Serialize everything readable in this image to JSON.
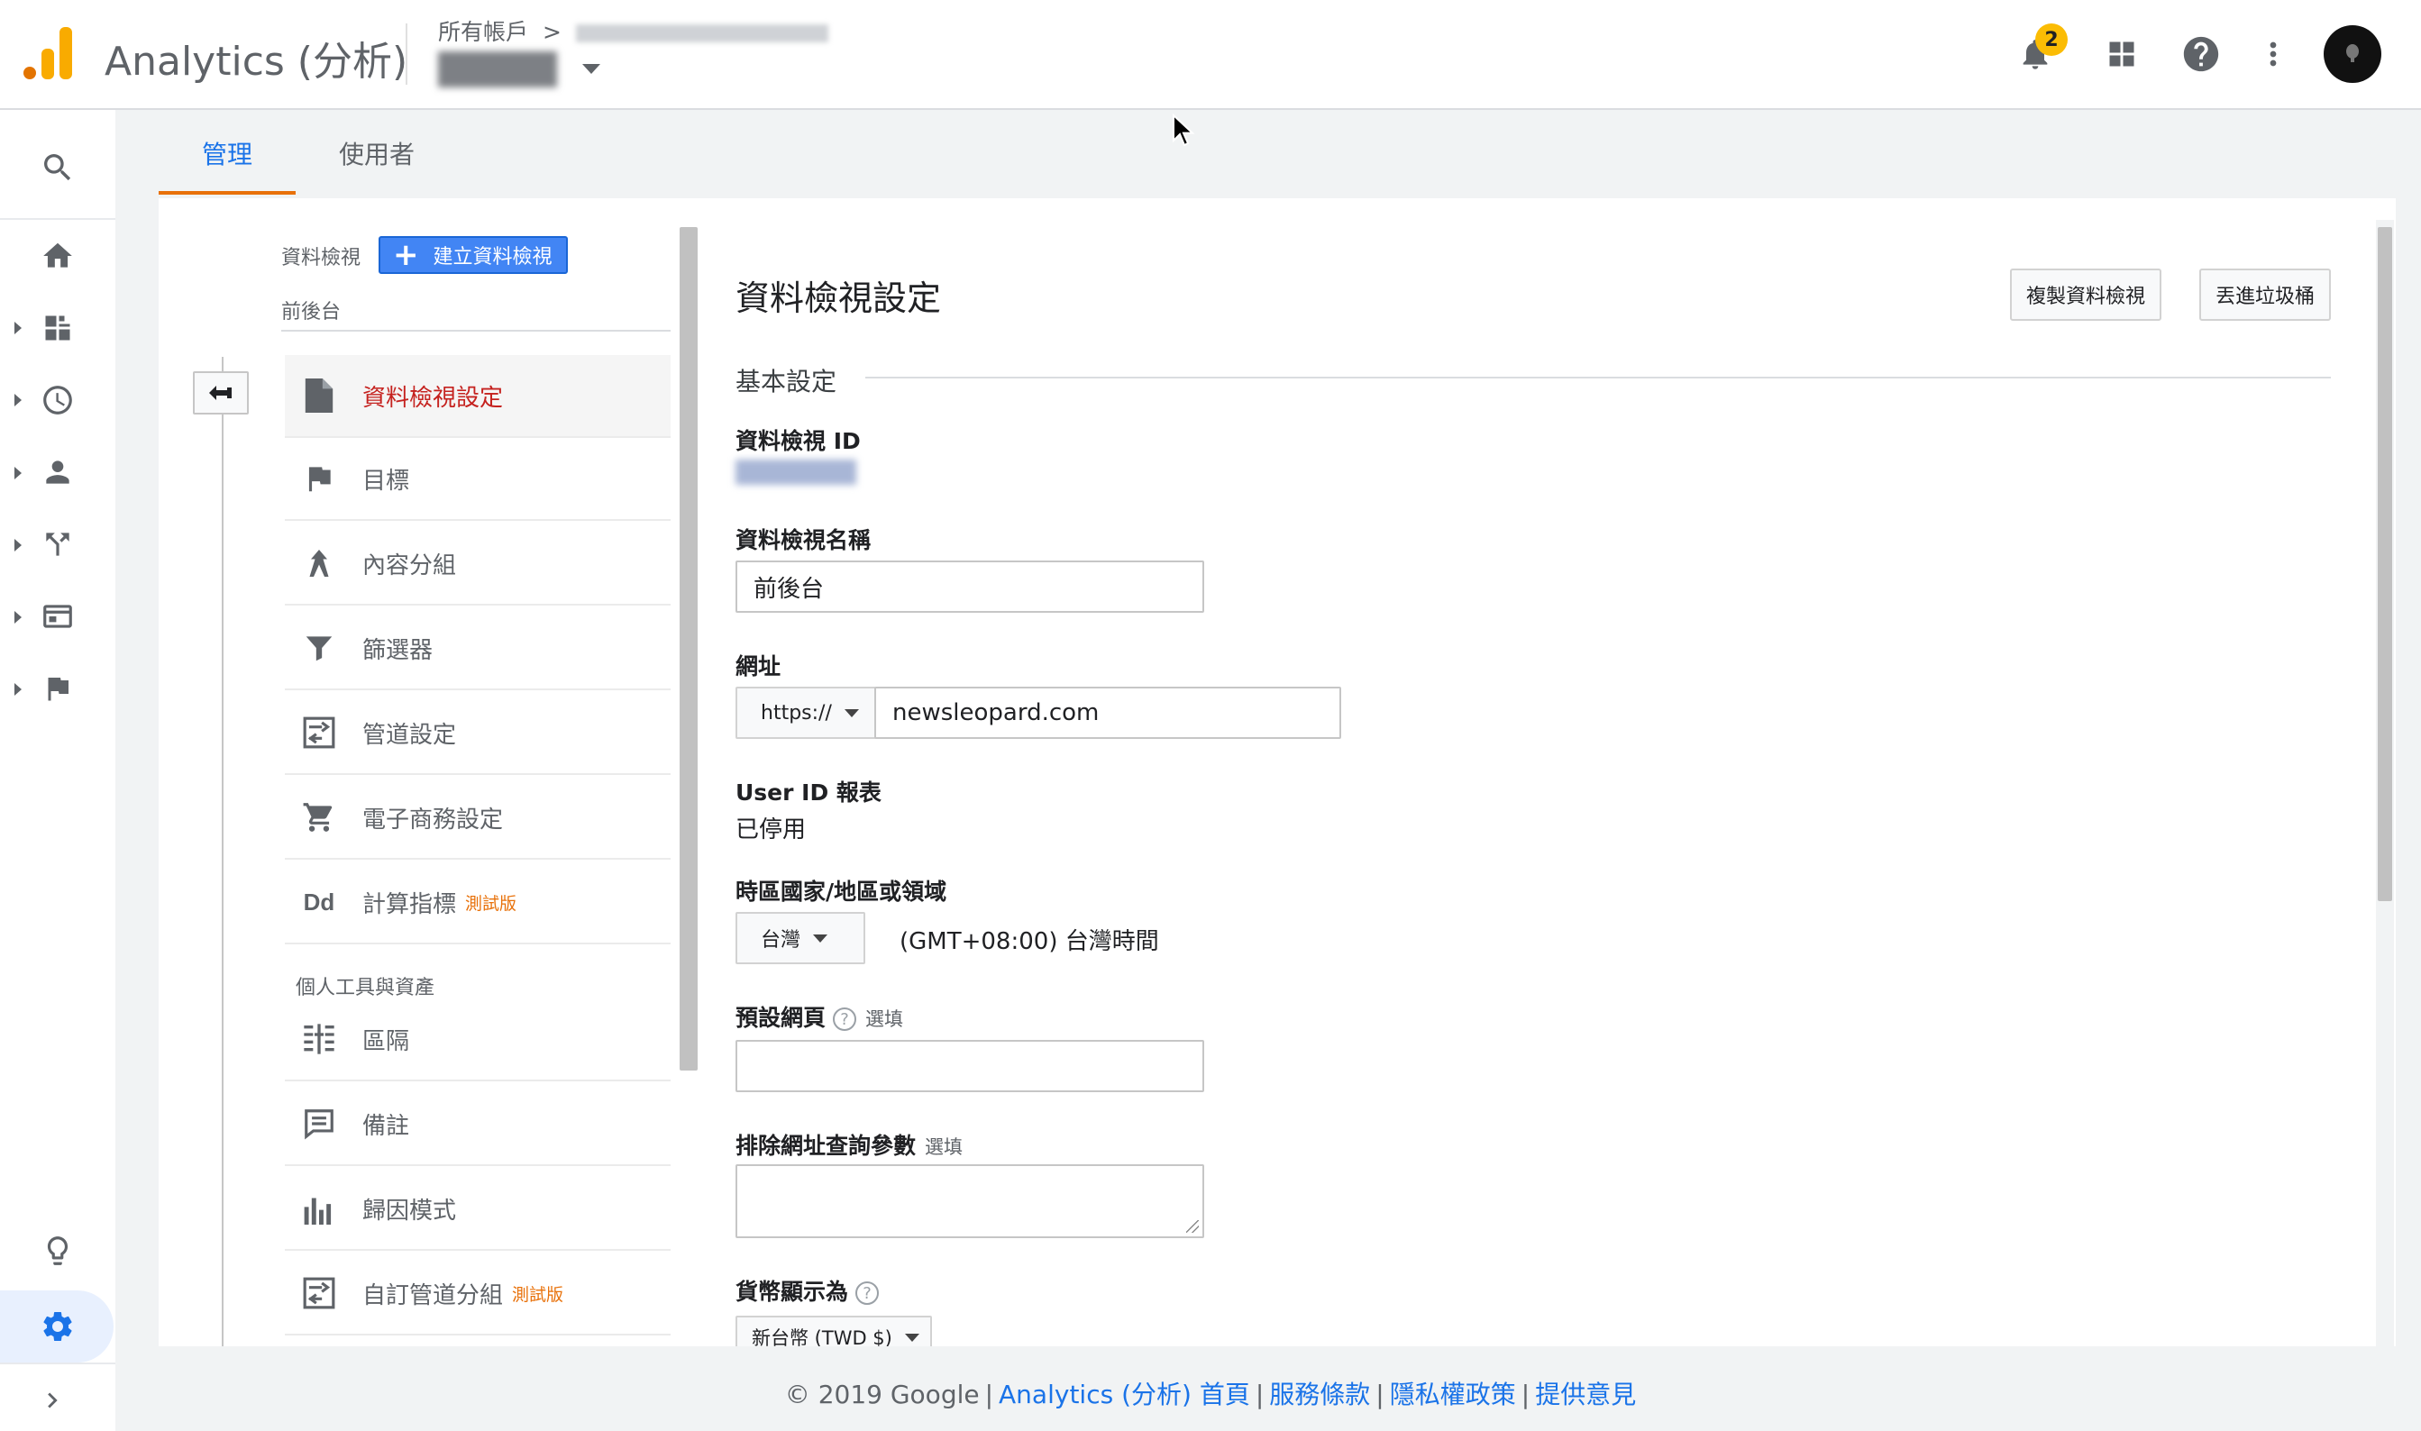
{
  "header": {
    "app_name": "Analytics (分析)",
    "breadcrumb": "所有帳戶",
    "property_name": "前後台",
    "notification_count": "2",
    "colors": {
      "logo_orange": "#f9ab00",
      "logo_dark": "#e37400"
    }
  },
  "tabs": [
    {
      "label": "管理",
      "active": true
    },
    {
      "label": "使用者",
      "active": false
    }
  ],
  "view_panel": {
    "label": "資料檢視",
    "create_button": "建立資料檢視",
    "current_view": "前後台",
    "menu": [
      {
        "label": "資料檢視設定",
        "icon": "document-icon",
        "active": true
      },
      {
        "label": "目標",
        "icon": "flag-icon"
      },
      {
        "label": "內容分組",
        "icon": "content-grouping-icon"
      },
      {
        "label": "篩選器",
        "icon": "filter-icon"
      },
      {
        "label": "管道設定",
        "icon": "funnel-settings-icon"
      },
      {
        "label": "電子商務設定",
        "icon": "cart-icon"
      },
      {
        "label": "計算指標",
        "icon": "dd-icon",
        "beta": "測試版"
      }
    ],
    "personal_title": "個人工具與資產",
    "personal_menu": [
      {
        "label": "區隔",
        "icon": "segments-icon"
      },
      {
        "label": "備註",
        "icon": "annotation-icon"
      },
      {
        "label": "歸因模式",
        "icon": "attribution-icon"
      },
      {
        "label": "自訂管道分組",
        "icon": "custom-channel-icon",
        "beta": "測試版"
      }
    ]
  },
  "settings": {
    "title": "資料檢視設定",
    "copy_button": "複製資料檢視",
    "trash_button": "丟進垃圾桶",
    "section_basic": "基本設定",
    "view_id_label": "資料檢視 ID",
    "view_name_label": "資料檢視名稱",
    "view_name_value": "前後台",
    "url_label": "網址",
    "url_protocol": "https://",
    "url_value": "newsleopard.com",
    "user_id_label": "User ID 報表",
    "user_id_value": "已停用",
    "timezone_label": "時區國家/地區或領域",
    "timezone_country": "台灣",
    "timezone_value": "(GMT+08:00) 台灣時間",
    "default_page_label": "預設網頁",
    "default_page_opt": "選填",
    "exclude_params_label": "排除網址查詢參數",
    "exclude_params_opt": "選填",
    "currency_label": "貨幣顯示為",
    "currency_value": "新台幣 (TWD $)"
  },
  "footer": {
    "copyright": "© 2019 Google",
    "link_home": "Analytics (分析) 首頁",
    "link_terms": "服務條款",
    "link_privacy": "隱私權政策",
    "link_feedback": "提供意見"
  }
}
